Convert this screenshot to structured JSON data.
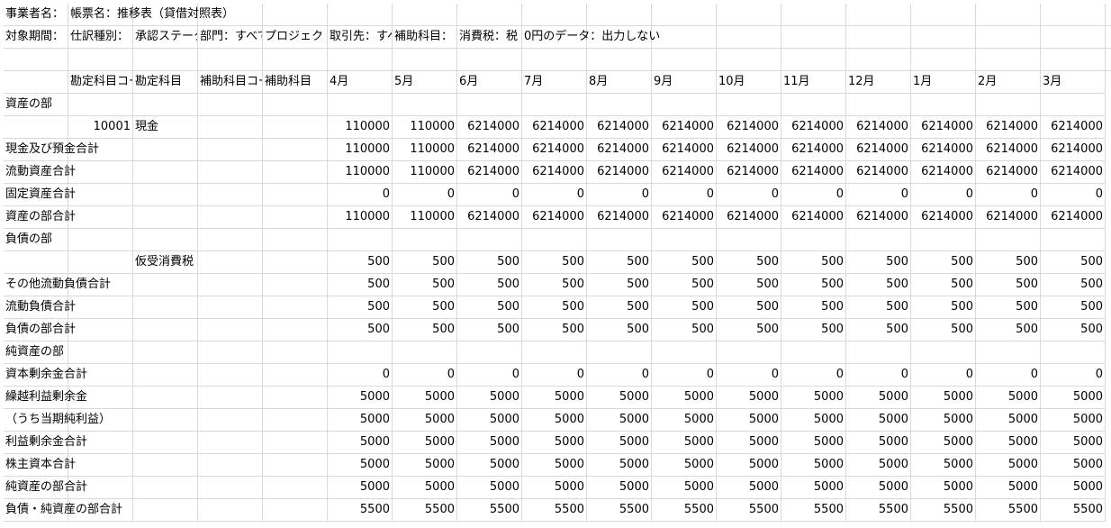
{
  "row1": {
    "a": "事業者名：",
    "b": "帳票名：推移表（貸借対照表）"
  },
  "row2": {
    "a": "対象期間：",
    "b": "仕訳種別：",
    "c": "承認ステータス：",
    "d": "部門：すべて",
    "e": "プロジェクト：",
    "f": "取引先：すべて",
    "g": "補助科目：",
    "h": "消費税：税",
    "i": "0円のデータ：出力しない"
  },
  "header": {
    "code": "勘定科目コード",
    "name": "勘定科目",
    "subcode": "補助科目コード",
    "subname": "補助科目",
    "months": [
      "4月",
      "5月",
      "6月",
      "7月",
      "8月",
      "9月",
      "10月",
      "11月",
      "12月",
      "1月",
      "2月",
      "3月"
    ]
  },
  "rows": [
    {
      "label": "資産の部",
      "code": "",
      "name": "",
      "values": []
    },
    {
      "label": "",
      "code": "10001",
      "name": "現金",
      "values": [
        "110000",
        "110000",
        "6214000",
        "6214000",
        "6214000",
        "6214000",
        "6214000",
        "6214000",
        "6214000",
        "6214000",
        "6214000",
        "6214000"
      ]
    },
    {
      "label": "現金及び預金合計",
      "code": "",
      "name": "",
      "values": [
        "110000",
        "110000",
        "6214000",
        "6214000",
        "6214000",
        "6214000",
        "6214000",
        "6214000",
        "6214000",
        "6214000",
        "6214000",
        "6214000"
      ]
    },
    {
      "label": "流動資産合計",
      "code": "",
      "name": "",
      "values": [
        "110000",
        "110000",
        "6214000",
        "6214000",
        "6214000",
        "6214000",
        "6214000",
        "6214000",
        "6214000",
        "6214000",
        "6214000",
        "6214000"
      ]
    },
    {
      "label": "固定資産合計",
      "code": "",
      "name": "",
      "values": [
        "0",
        "0",
        "0",
        "0",
        "0",
        "0",
        "0",
        "0",
        "0",
        "0",
        "0",
        "0"
      ]
    },
    {
      "label": "資産の部合計",
      "code": "",
      "name": "",
      "values": [
        "110000",
        "110000",
        "6214000",
        "6214000",
        "6214000",
        "6214000",
        "6214000",
        "6214000",
        "6214000",
        "6214000",
        "6214000",
        "6214000"
      ]
    },
    {
      "label": "負債の部",
      "code": "",
      "name": "",
      "values": []
    },
    {
      "label": "",
      "code": "",
      "name": "仮受消費税",
      "values": [
        "500",
        "500",
        "500",
        "500",
        "500",
        "500",
        "500",
        "500",
        "500",
        "500",
        "500",
        "500"
      ]
    },
    {
      "label": "その他流動負債合計",
      "code": "",
      "name": "",
      "values": [
        "500",
        "500",
        "500",
        "500",
        "500",
        "500",
        "500",
        "500",
        "500",
        "500",
        "500",
        "500"
      ]
    },
    {
      "label": "流動負債合計",
      "code": "",
      "name": "",
      "values": [
        "500",
        "500",
        "500",
        "500",
        "500",
        "500",
        "500",
        "500",
        "500",
        "500",
        "500",
        "500"
      ]
    },
    {
      "label": "負債の部合計",
      "code": "",
      "name": "",
      "values": [
        "500",
        "500",
        "500",
        "500",
        "500",
        "500",
        "500",
        "500",
        "500",
        "500",
        "500",
        "500"
      ]
    },
    {
      "label": "純資産の部",
      "code": "",
      "name": "",
      "values": []
    },
    {
      "label": "資本剰余金合計",
      "code": "",
      "name": "",
      "values": [
        "0",
        "0",
        "0",
        "0",
        "0",
        "0",
        "0",
        "0",
        "0",
        "0",
        "0",
        "0"
      ]
    },
    {
      "label": "繰越利益剰余金",
      "code": "",
      "name": "",
      "values": [
        "5000",
        "5000",
        "5000",
        "5000",
        "5000",
        "5000",
        "5000",
        "5000",
        "5000",
        "5000",
        "5000",
        "5000"
      ]
    },
    {
      "label": "（うち当期純利益）",
      "code": "",
      "name": "",
      "values": [
        "5000",
        "5000",
        "5000",
        "5000",
        "5000",
        "5000",
        "5000",
        "5000",
        "5000",
        "5000",
        "5000",
        "5000"
      ]
    },
    {
      "label": "利益剰余金合計",
      "code": "",
      "name": "",
      "values": [
        "5000",
        "5000",
        "5000",
        "5000",
        "5000",
        "5000",
        "5000",
        "5000",
        "5000",
        "5000",
        "5000",
        "5000"
      ]
    },
    {
      "label": "株主資本合計",
      "code": "",
      "name": "",
      "values": [
        "5000",
        "5000",
        "5000",
        "5000",
        "5000",
        "5000",
        "5000",
        "5000",
        "5000",
        "5000",
        "5000",
        "5000"
      ]
    },
    {
      "label": "純資産の部合計",
      "code": "",
      "name": "",
      "values": [
        "5000",
        "5000",
        "5000",
        "5000",
        "5000",
        "5000",
        "5000",
        "5000",
        "5000",
        "5000",
        "5000",
        "5000"
      ]
    },
    {
      "label": "負債・純資産の部合計",
      "code": "",
      "name": "",
      "values": [
        "5500",
        "5500",
        "5500",
        "5500",
        "5500",
        "5500",
        "5500",
        "5500",
        "5500",
        "5500",
        "5500",
        "5500"
      ]
    }
  ]
}
